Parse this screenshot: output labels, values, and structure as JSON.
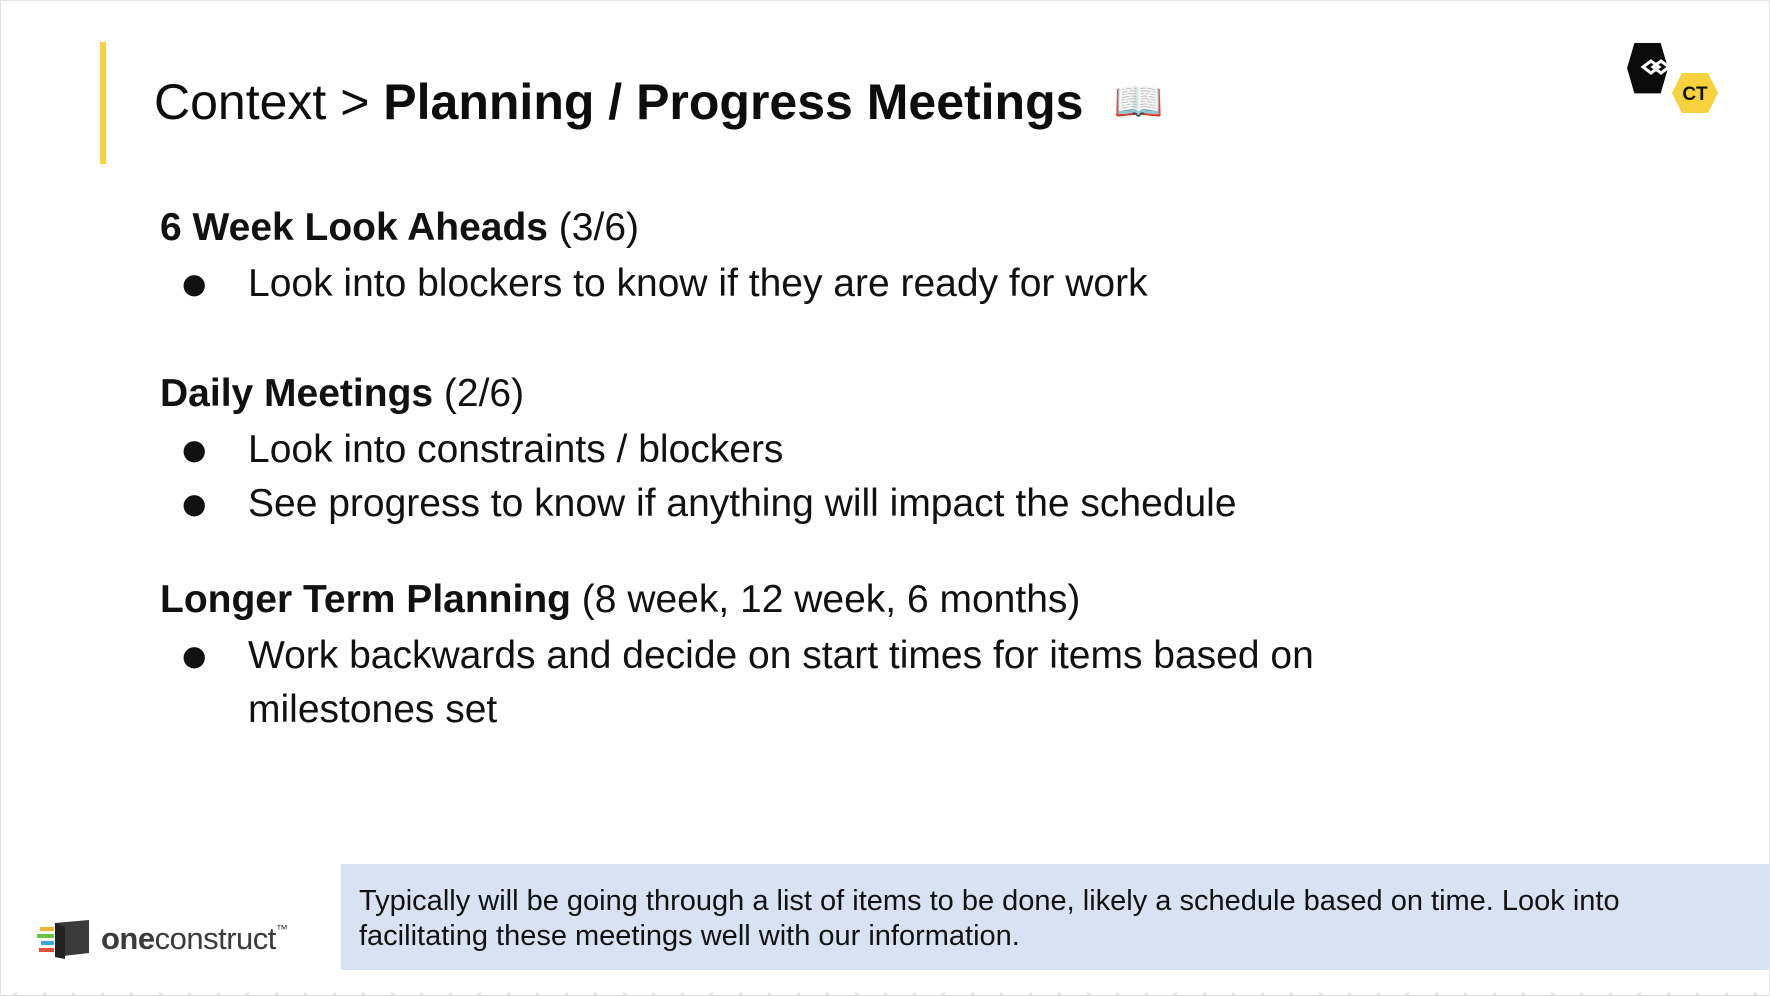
{
  "slide": {
    "title_crumb": "Context > ",
    "title_current": "Planning / Progress Meetings",
    "title_icon": "open-book-icon",
    "title_icon_glyph": "📖",
    "corner_logo_text": "CT",
    "accent_color": "#f7d23e"
  },
  "sections": [
    {
      "heading": "6 Week Look Aheads",
      "note": " (3/6)",
      "bullets": [
        "Look into blockers to know if they are ready for work"
      ]
    },
    {
      "heading": "Daily Meetings",
      "note": " (2/6)",
      "bullets": [
        "Look into constraints / blockers",
        "See progress to know if anything will impact the schedule"
      ]
    },
    {
      "heading": "Longer Term Planning",
      "note": " (8 week, 12 week, 6 months)",
      "bullets": [
        "Work backwards and decide on start times for items based on milestones set"
      ]
    }
  ],
  "bullet_glyph": "●",
  "note_box": {
    "text": "Typically will be going through a list of items to be done, likely a schedule based on time.  Look into facilitating these meetings well with our information.",
    "background": "#d7e3f2"
  },
  "footer_logo": {
    "bold": "one",
    "regular": "construct",
    "trademark": "™"
  }
}
